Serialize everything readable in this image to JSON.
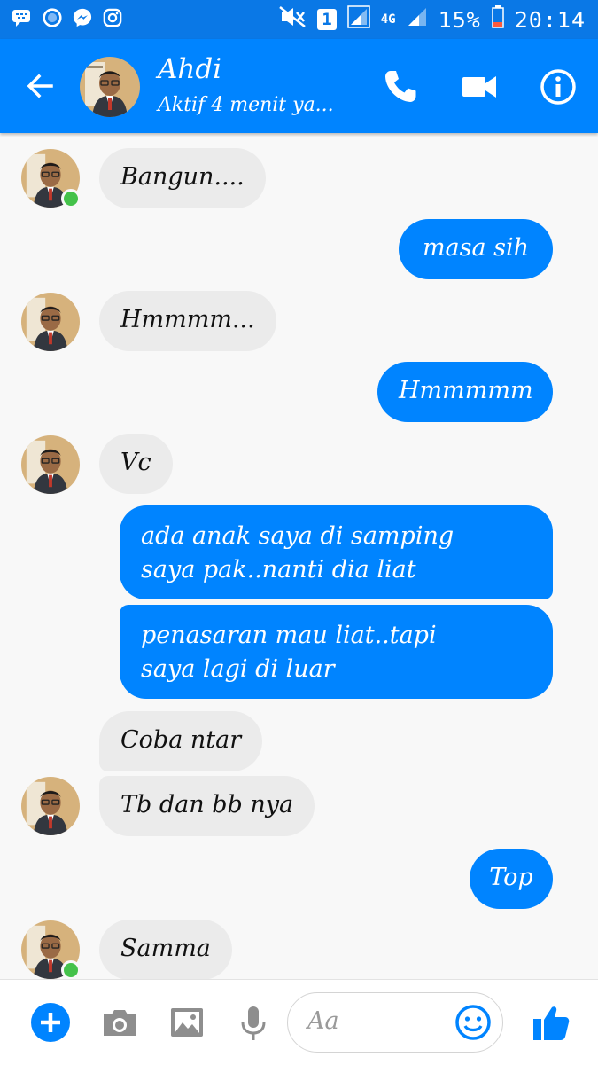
{
  "status_bar": {
    "notification_icons": [
      "bbm-icon",
      "circle-icon",
      "messenger-icon",
      "instagram-icon"
    ],
    "sim_label": "1",
    "network_label": "4G",
    "battery_percent": "15%",
    "time": "20:14"
  },
  "header": {
    "contact_name": "Ahdi",
    "presence": "Aktif 4 menit ya...",
    "actions": [
      "back-arrow-icon",
      "phone-icon",
      "video-icon",
      "info-icon"
    ]
  },
  "messages": [
    {
      "from": "contact",
      "text": "Bangun....",
      "avatar": true,
      "online": true
    },
    {
      "from": "me",
      "text": "masa sih"
    },
    {
      "from": "contact",
      "text": "Hmmmm...",
      "avatar": true,
      "online": false
    },
    {
      "from": "me",
      "text": "Hmmmmm"
    },
    {
      "from": "contact",
      "text": "Vc",
      "avatar": true,
      "online": false
    },
    {
      "from": "me",
      "text": "ada anak saya di samping saya pak..nanti dia liat",
      "lines": [
        "ada anak saya di samping",
        "saya pak..nanti dia liat"
      ]
    },
    {
      "from": "me",
      "text": "penasaran mau liat..tapi saya lagi di luar",
      "lines": [
        "penasaran mau liat..tapi",
        "saya lagi di luar"
      ]
    },
    {
      "from": "contact",
      "text": "Coba ntar",
      "avatar": false
    },
    {
      "from": "contact",
      "text": "Tb dan bb nya",
      "avatar": true,
      "online": false
    },
    {
      "from": "me",
      "text": "Top"
    },
    {
      "from": "contact",
      "text": "Samma",
      "avatar": true,
      "online": true
    }
  ],
  "composer": {
    "placeholder": "Aa",
    "icons": [
      "plus-icon",
      "camera-icon",
      "gallery-icon",
      "microphone-icon",
      "emoji-icon",
      "thumbs-up-icon"
    ]
  },
  "colors": {
    "status_bar": "#0a78e6",
    "header": "#0084ff",
    "outgoing_bubble": "#0084ff",
    "incoming_bubble": "#ebebeb",
    "online_dot": "#44c24a"
  }
}
